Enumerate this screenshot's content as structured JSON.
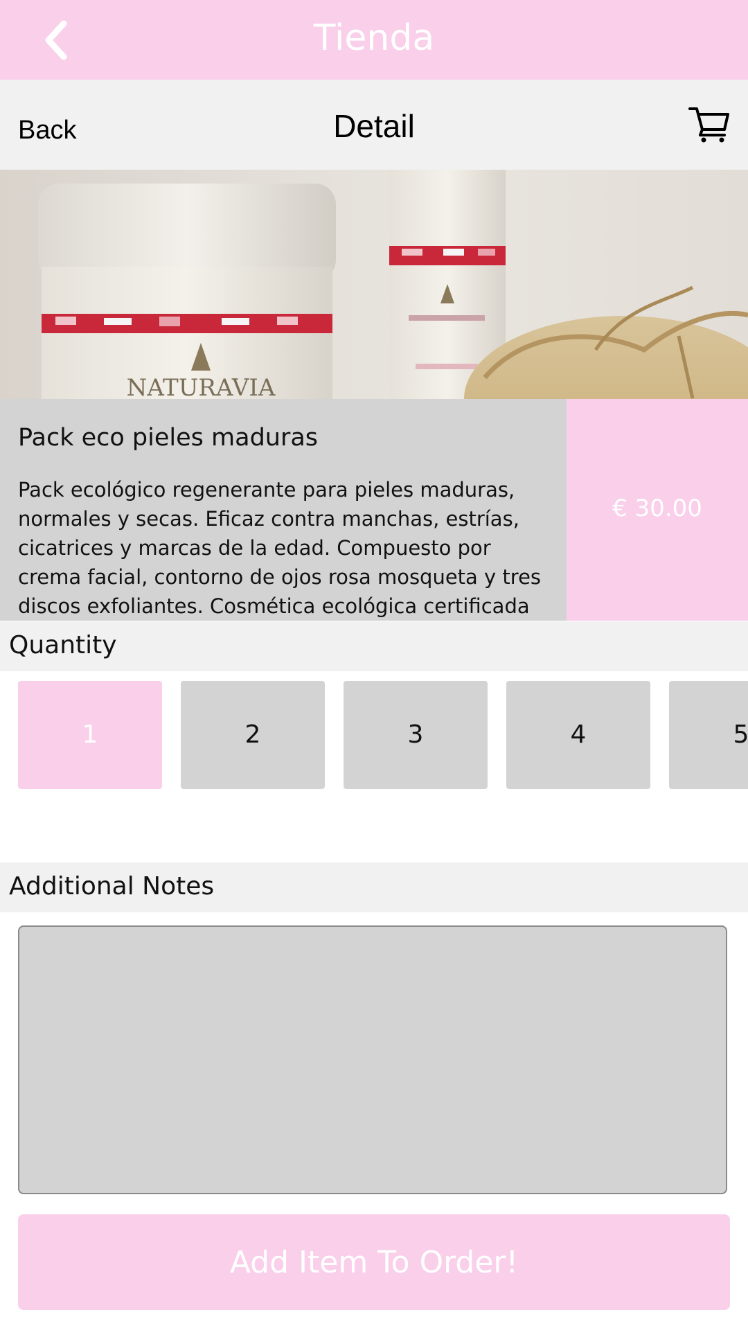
{
  "app": {
    "title": "Tienda"
  },
  "nav": {
    "back_label": "Back",
    "title": "Detail"
  },
  "product": {
    "name": "Pack eco pieles maduras",
    "description": "Pack ecológico regenerante para pieles maduras, normales y secas. Eficaz contra manchas, estrías, cicatrices y marcas de la edad. Compuesto por crema facial, contorno de ojos rosa mosqueta y tres discos exfoliantes. Cosmética ecológica certificada",
    "price": "€ 30.00",
    "image_brand": "NATURAVIA"
  },
  "quantity": {
    "header": "Quantity",
    "options": [
      "1",
      "2",
      "3",
      "4",
      "5"
    ],
    "selected": "1"
  },
  "notes": {
    "header": "Additional Notes",
    "value": ""
  },
  "actions": {
    "add_label": "Add Item To Order!"
  },
  "colors": {
    "accent": "#f9cfea",
    "panel": "#d3d3d3",
    "header_bg": "#f1f1f1"
  },
  "icons": {
    "back": "chevron-left-icon",
    "cart": "cart-icon"
  }
}
